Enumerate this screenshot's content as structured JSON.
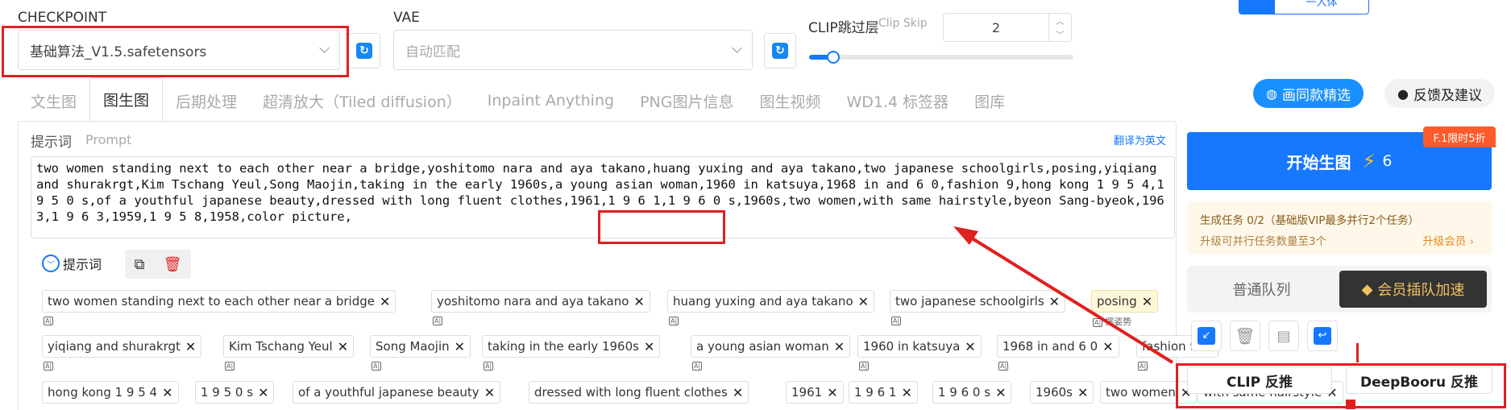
{
  "checkpoint": {
    "label": "CHECKPOINT",
    "value": "基础算法_V1.5.safetensors"
  },
  "vae": {
    "label": "VAE",
    "value": "自动匹配"
  },
  "clip": {
    "label": "CLIP跳过层",
    "sub_label": "Clip Skip",
    "value": "2",
    "slider_fraction": 0.09
  },
  "top_badge": {
    "label": "一人体"
  },
  "tabs": [
    {
      "label": "文生图"
    },
    {
      "label": "图生图"
    },
    {
      "label": "后期处理"
    },
    {
      "label": "超清放大（Tiled diffusion）"
    },
    {
      "label": "Inpaint Anything"
    },
    {
      "label": "PNG图片信息"
    },
    {
      "label": "图生视频"
    },
    {
      "label": "WD1.4 标签器"
    },
    {
      "label": "图库"
    }
  ],
  "actions": {
    "similar": "画同款精选",
    "feedback": "反馈及建议"
  },
  "prompt": {
    "label": "提示词",
    "sub_label": "Prompt",
    "translate": "翻译为英文",
    "text": "two women standing next to each other near a bridge,yoshitomo nara and aya takano,huang yuxing and aya takano,two japanese schoolgirls,posing,yiqiang and shurakrgt,Kim Tschang Yeul,Song Maojin,taking in the early 1960s,a young asian woman,1960 in katsuya,1968 in and 6 0,fashion 9,hong kong 1 9 5 4,1 9 5 0 s,of a youthful japanese beauty,dressed with long fluent clothes,1961,1 9 6 1,1 9 6 0 s,1960s,two women,with same hairstyle,byeon Sang-byeok,1963,1 9 6 3,1959,1 9 5 8,1958,color picture,",
    "tags_label": "提示词"
  },
  "tags": {
    "row1": [
      "two women standing next to each other near a bridge",
      "yoshitomo nara and aya takano",
      "huang yuxing and aya takano",
      "two japanese schoolgirls",
      "posing"
    ],
    "row1_sub": "摆姿势",
    "row2": [
      "yiqiang and shurakrgt",
      "Kim Tschang Yeul",
      "Song Maojin",
      "taking in the early 1960s",
      "a young asian woman",
      "1960 in katsuya",
      "1968 in and 6 0",
      "fashion 9"
    ],
    "row3": [
      "hong kong 1 9 5 4",
      "1 9 5 0 s",
      "of a youthful japanese beauty",
      "dressed with long fluent clothes",
      "1961",
      "1 9 6 1",
      "1 9 6 0 s",
      "1960s",
      "two women",
      "with same hairstyle"
    ]
  },
  "generate": {
    "label": "开始生图",
    "cost": "6",
    "promo": "F.1限时5折"
  },
  "task": {
    "status": "生成任务 0/2（基础版VIP最多并行2个任务）",
    "upgrade_hint": "升级可并行任务数量至3个",
    "upgrade_link": "升级会员 ›"
  },
  "queue": {
    "normal": "普通队列",
    "vip": "会员插队加速"
  },
  "reverse": {
    "clip": "CLIP 反推",
    "deepbooru": "DeepBooru 反推"
  },
  "colors": {
    "accent": "#1677ff",
    "red_annotation": "#e02020"
  }
}
